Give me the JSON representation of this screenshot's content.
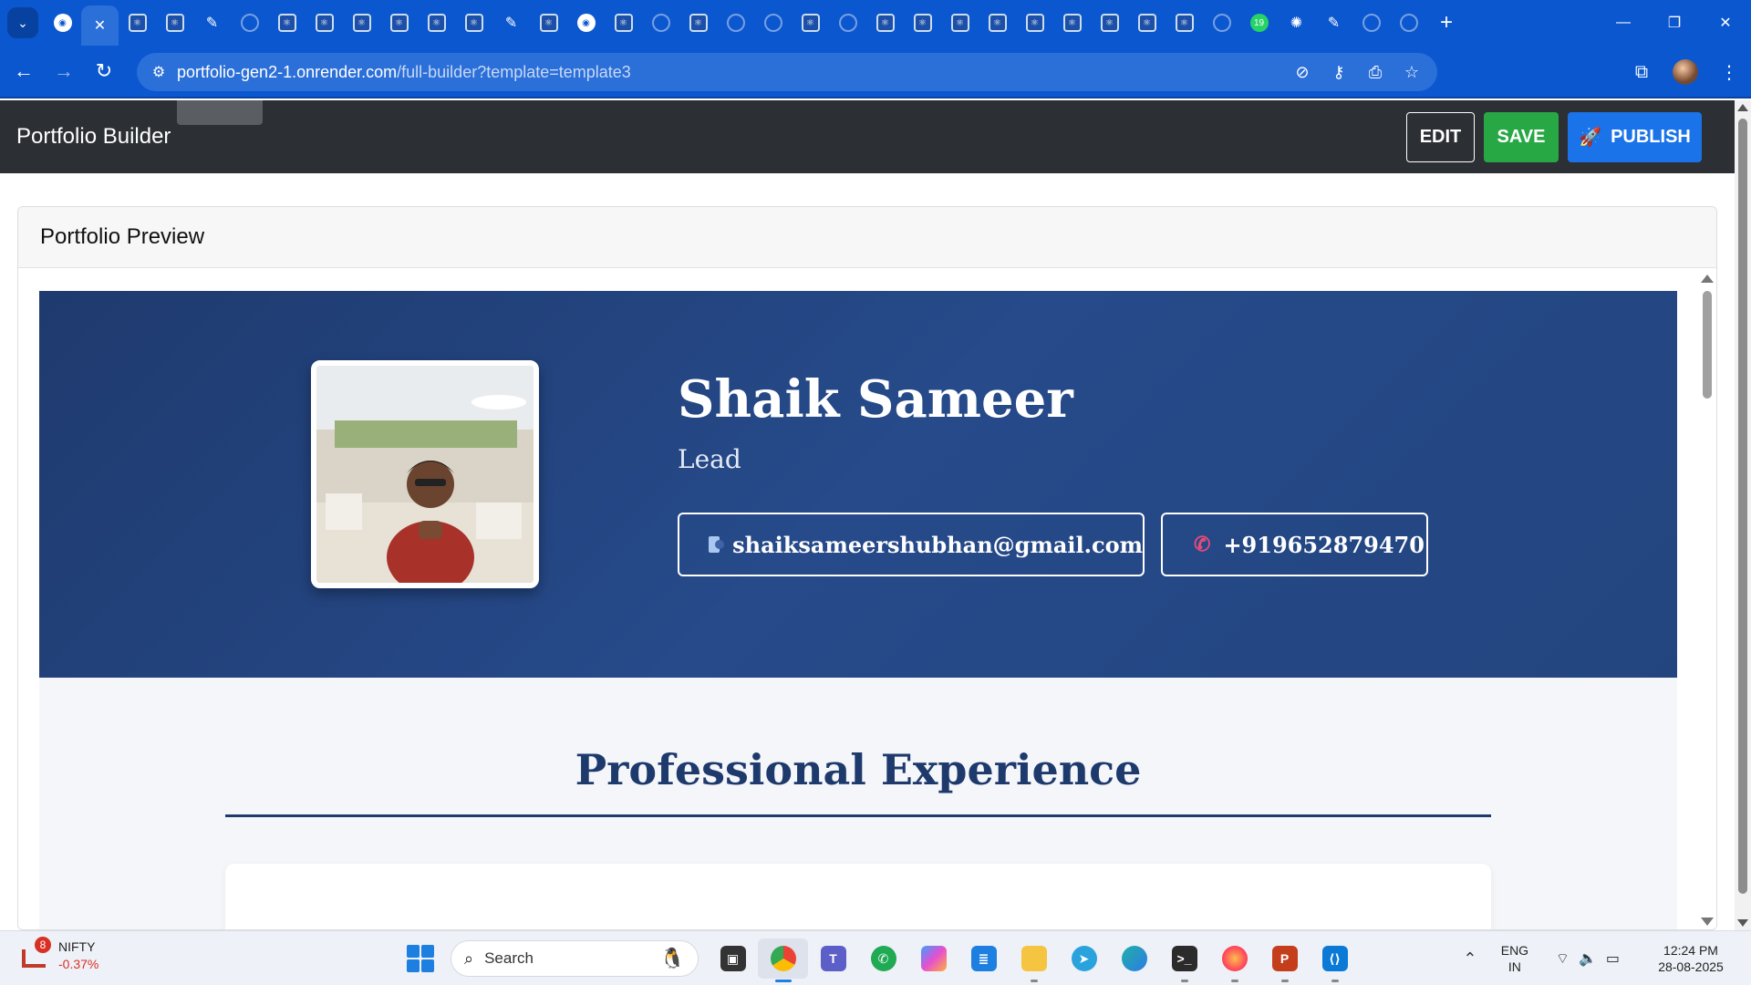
{
  "browser": {
    "tab_count_icons": [
      "react",
      "react",
      "react",
      "green-check",
      "globe",
      "react",
      "react",
      "react",
      "react",
      "react",
      "react",
      "react",
      "render",
      "react",
      "github",
      "react",
      "globe",
      "react",
      "globe",
      "globe",
      "react",
      "globe",
      "react",
      "react",
      "react",
      "react",
      "react",
      "react",
      "react",
      "react",
      "react",
      "globe",
      "whatsapp",
      "openai",
      "render",
      "globe",
      "globe"
    ],
    "url_host": "portfolio-gen2-1.onrender.com",
    "url_path": "/full-builder?template=template3"
  },
  "app": {
    "title": "Portfolio Builder",
    "edit_label": "EDIT",
    "save_label": "SAVE",
    "publish_label": "PUBLISH",
    "colors": {
      "header_bg": "#2c2f33",
      "save": "#28a745",
      "publish": "#1a73e8",
      "hero": "#23457f",
      "heading": "#1e3a6d"
    }
  },
  "preview": {
    "title": "Portfolio Preview",
    "name": "Shaik Sameer",
    "role": "Lead",
    "email": "shaiksameershubhan@gmail.com",
    "phone": "+919652879470",
    "section_title": "Professional Experience"
  },
  "taskbar": {
    "widget_badge": "8",
    "widget_name": "NIFTY",
    "widget_change": "-0.37%",
    "search_placeholder": "Search",
    "lang_line1": "ENG",
    "lang_line2": "IN",
    "time": "12:24 PM",
    "date": "28-08-2025"
  }
}
